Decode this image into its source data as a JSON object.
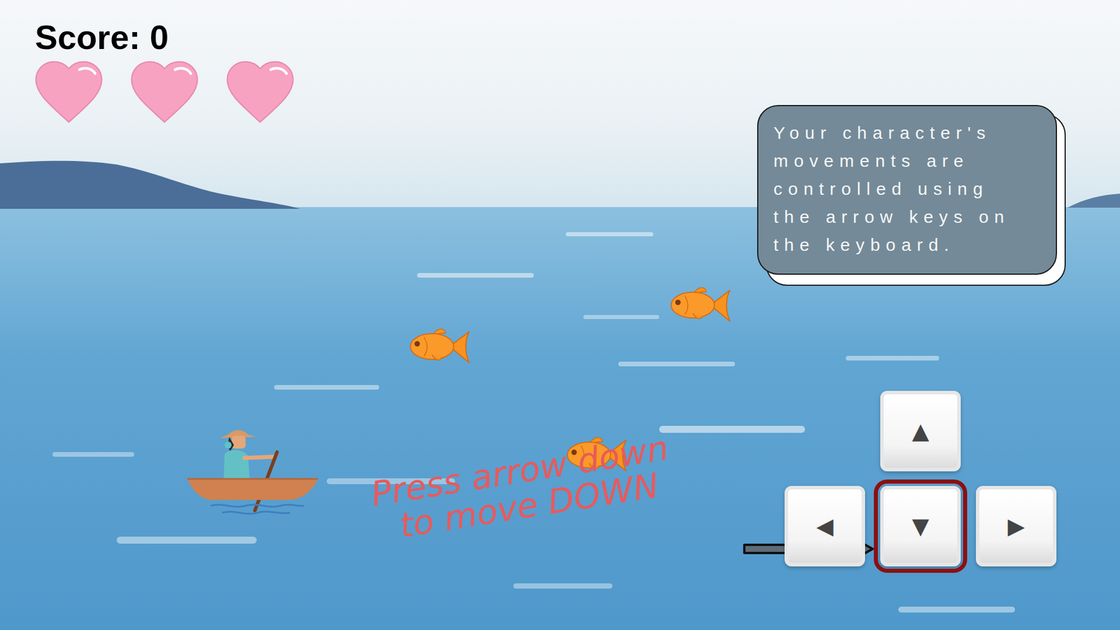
{
  "score": {
    "label": "Score: 0"
  },
  "lives": [
    {
      "filled": true
    },
    {
      "filled": true
    },
    {
      "filled": true
    }
  ],
  "tooltip": {
    "text": "Your character's movements are controlled using the arrow keys on the keyboard."
  },
  "hint": {
    "lines": [
      "Press arrow down",
      "to move DOWN"
    ]
  },
  "keys": [
    {
      "label": "▲",
      "selected": false
    },
    {
      "label": "◀",
      "selected": false
    },
    {
      "label": "▼",
      "selected": true
    },
    {
      "label": "▶",
      "selected": false
    }
  ]
}
